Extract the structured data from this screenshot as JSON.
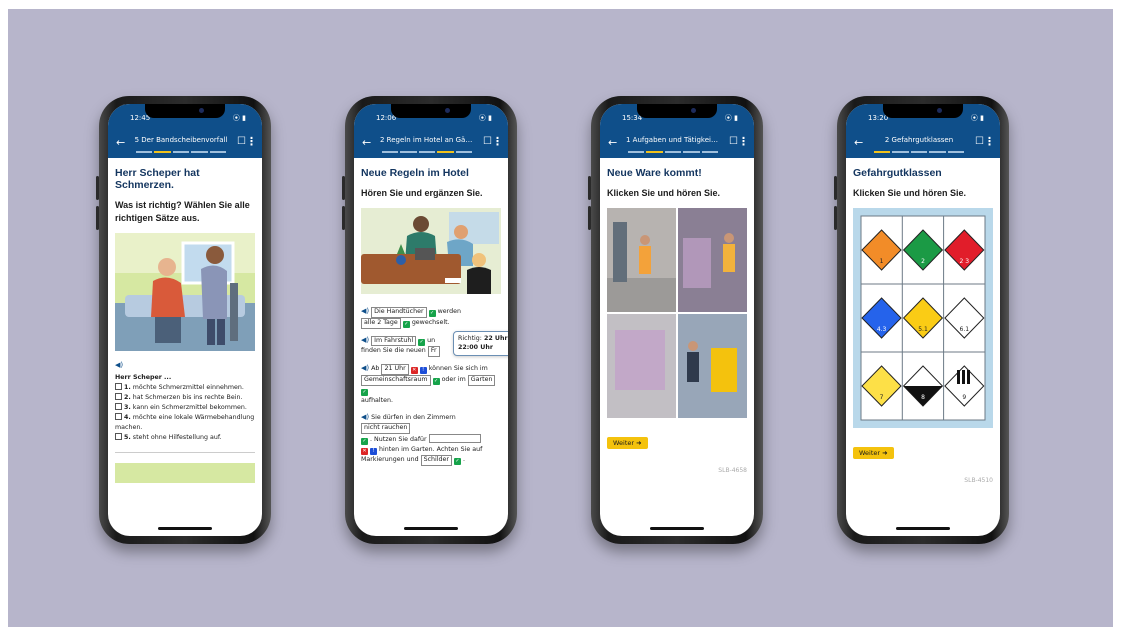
{
  "status_icons": "⦿ ▮",
  "icons": {
    "back": "←",
    "bookmark": "☐",
    "more": "⋮",
    "speaker": "◀)",
    "next_arrow": "➜",
    "check": "✓",
    "cross": "✕",
    "info": "!"
  },
  "colors": {
    "background": "#b7b5cb",
    "header": "#0f4f8a",
    "accent": "#f4c20d",
    "title": "#13355f",
    "correct": "#16a34a",
    "wrong": "#dc2626"
  },
  "phones": [
    {
      "time": "12:45",
      "header_title": "5 Der Bandscheibenvorfall",
      "heading": "Herr Scheper hat Schmerzen.",
      "instruction": "Was ist richtig? Wählen Sie alle richtigen Sätze aus.",
      "list_intro": "Herr Scheper ...",
      "options": [
        {
          "num": "1.",
          "text": "möchte Schmerzmittel einnehmen."
        },
        {
          "num": "2.",
          "text": "hat Schmerzen bis ins rechte Bein."
        },
        {
          "num": "3.",
          "text": "kann ein Schmerzmittel bekommen."
        },
        {
          "num": "4.",
          "text": "möchte eine lokale Wärmebehandlung machen."
        },
        {
          "num": "5.",
          "text": "steht ohne Hilfestellung auf."
        }
      ]
    },
    {
      "time": "12:06",
      "header_title": "2 Regeln im Hotel an Gäste ...",
      "heading": "Neue Regeln im Hotel",
      "instruction": "Hören Sie und ergänzen Sie.",
      "s1": {
        "gap1": "Die Handtücher",
        "t1": "werden",
        "gap2": "alle 2 Tage",
        "t2": "gewechselt."
      },
      "s2": {
        "gap1": "Im Fahrstuhl",
        "t1": "un",
        "t2": "finden Sie die neuen",
        "t3": "Fr",
        "tooltip_label": "Richtig:",
        "tooltip_value": "22 Uhr / 22:00 Uhr"
      },
      "s3": {
        "t0": "Ab",
        "gap1": "21 Uhr",
        "t1": "können Sie sich im",
        "gap2": "Gemeinschaftsraum",
        "t2": "oder im",
        "gap3": "Garten",
        "t3": "aufhalten."
      },
      "s4": {
        "t0": "Sie dürfen in den Zimmern",
        "gap1": "nicht rauchen",
        "t1": ". Nutzen Sie dafür",
        "t2": "hinten im Garten. Achten Sie auf",
        "t3": "Markierungen und",
        "gap2": "Schilder",
        "t4": "."
      }
    },
    {
      "time": "15:34",
      "header_title": "1 Aufgaben und Tätigkeiten",
      "heading": "Neue Ware kommt!",
      "instruction": "Klicken Sie und hören Sie.",
      "button": "Weiter",
      "code": "SLB-4658"
    },
    {
      "time": "13:20",
      "header_title": "2 Gefahrgutklassen",
      "heading": "Gefahrgutklassen",
      "instruction": "Klicken Sie und hören Sie.",
      "button": "Weiter",
      "code": "SLB-4510",
      "hazard_labels": [
        "1",
        "2",
        "2 3",
        "4.3",
        "5.1",
        "6.1",
        "7",
        "8",
        "9"
      ]
    }
  ]
}
